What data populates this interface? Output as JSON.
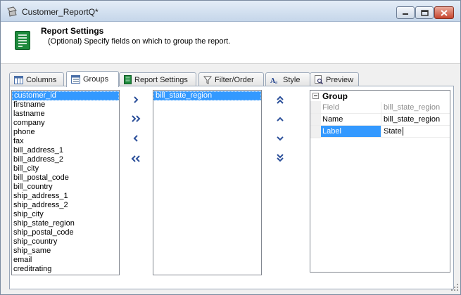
{
  "window": {
    "title": "Customer_ReportQ*"
  },
  "header": {
    "title": "Report Settings",
    "description": "(Optional) Specify fields on which to group the report."
  },
  "tabs": [
    {
      "label": "Columns",
      "icon": "columns-icon",
      "active": false
    },
    {
      "label": "Groups",
      "icon": "groups-icon",
      "active": true
    },
    {
      "label": "Report Settings",
      "icon": "report-settings-icon",
      "active": false
    },
    {
      "label": "Filter/Order",
      "icon": "filter-icon",
      "active": false
    },
    {
      "label": "Style",
      "icon": "style-icon",
      "active": false
    },
    {
      "label": "Preview",
      "icon": "preview-icon",
      "active": false
    }
  ],
  "available_fields": {
    "selected": "customer_id",
    "items": [
      "customer_id",
      "firstname",
      "lastname",
      "company",
      "phone",
      "fax",
      "bill_address_1",
      "bill_address_2",
      "bill_city",
      "bill_postal_code",
      "bill_country",
      "ship_address_1",
      "ship_address_2",
      "ship_city",
      "ship_state_region",
      "ship_postal_code",
      "ship_country",
      "ship_same",
      "email",
      "creditrating"
    ]
  },
  "group_fields": {
    "selected": "bill_state_region",
    "items": [
      "bill_state_region"
    ]
  },
  "move_buttons": [
    "add-selected",
    "add-all",
    "remove-selected",
    "remove-all"
  ],
  "order_buttons": [
    "move-to-top",
    "move-up",
    "move-down",
    "move-to-bottom"
  ],
  "properties": {
    "category": "Group",
    "rows": [
      {
        "name": "Field",
        "value": "bill_state_region",
        "disabled": true
      },
      {
        "name": "Name",
        "value": "bill_state_region",
        "disabled": false
      },
      {
        "name": "Label",
        "value": "State",
        "disabled": false,
        "selected": true
      }
    ]
  },
  "colors": {
    "selection": "#3399ff",
    "arrow": "#2b4f9a",
    "titlebar": "#c5d6ea"
  }
}
